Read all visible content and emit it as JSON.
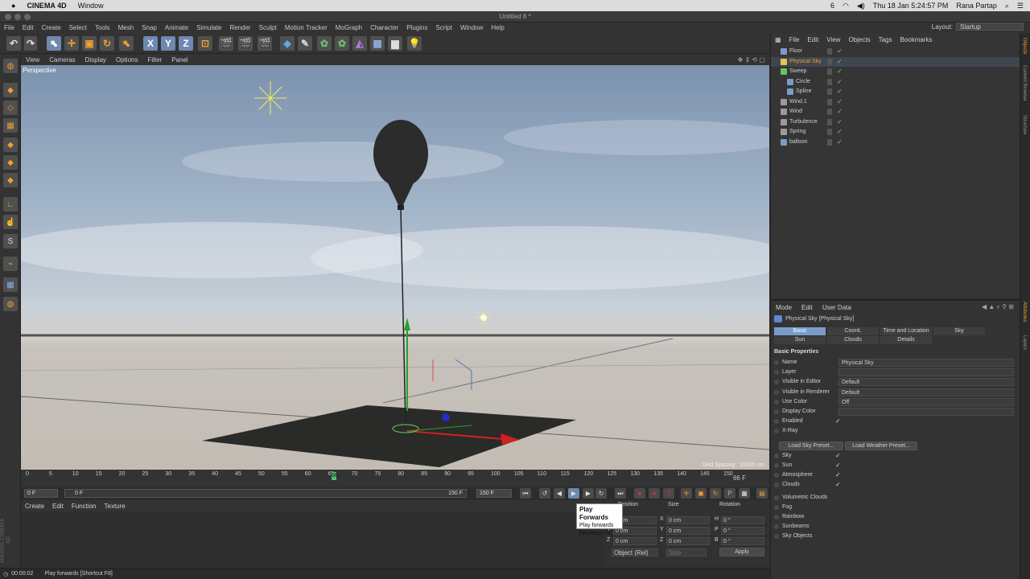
{
  "macbar": {
    "app": "CINEMA 4D",
    "window": "Window",
    "battery": "6",
    "datetime": "Thu 18 Jan  5:24:57 PM",
    "user": "Rana Partap"
  },
  "title": "Untitled 8 *",
  "menu": [
    "File",
    "Edit",
    "Create",
    "Select",
    "Tools",
    "Mesh",
    "Snap",
    "Animate",
    "Simulate",
    "Render",
    "Sculpt",
    "Motion Tracker",
    "MoGraph",
    "Character",
    "Plugins",
    "Script",
    "Window",
    "Help"
  ],
  "layout": {
    "label": "Layout:",
    "value": "Startup"
  },
  "viewport": {
    "menu": [
      "View",
      "Cameras",
      "Display",
      "Options",
      "Filter",
      "Panel"
    ],
    "label": "Perspective",
    "grid_spacing": "Grid Spacing : 10000 cm"
  },
  "timeline": {
    "ticks": [
      "0",
      "5",
      "10",
      "15",
      "20",
      "25",
      "30",
      "35",
      "40",
      "45",
      "50",
      "55",
      "60",
      "65",
      "70",
      "75",
      "80",
      "85",
      "90",
      "95",
      "100",
      "105",
      "110",
      "115",
      "120",
      "125",
      "130",
      "135",
      "140",
      "145",
      "150"
    ],
    "current_frame": "66 F",
    "start": "0 F",
    "min": "0 F",
    "max": "150 F",
    "end": "150 F",
    "play_frame": "66"
  },
  "material_menu": [
    "Create",
    "Edit",
    "Function",
    "Texture"
  ],
  "tooltip": {
    "title": "Play Forwards",
    "line1": "Play forwards",
    "line2": "[Shortcut F8]"
  },
  "coords": {
    "headers": [
      "Position",
      "Size",
      "Rotation"
    ],
    "rows": [
      {
        "axis": "X",
        "pos": "0 cm",
        "sizeaxis": "X",
        "size": "0 cm",
        "rotaxis": "H",
        "rot": "0 °"
      },
      {
        "axis": "Y",
        "pos": "0 cm",
        "sizeaxis": "Y",
        "size": "0 cm",
        "rotaxis": "P",
        "rot": "0 °"
      },
      {
        "axis": "Z",
        "pos": "0 cm",
        "sizeaxis": "Z",
        "size": "0 cm",
        "rotaxis": "B",
        "rot": "0 °"
      }
    ],
    "mode": "Object (Rel)",
    "size_mode": "Size",
    "apply": "Apply"
  },
  "maxon": "MAXON CINEMA 4D",
  "status": {
    "time": "00:00:02",
    "message": "Play forwards [Shortcut F8]"
  },
  "objects": {
    "menu": [
      "File",
      "Edit",
      "View",
      "Objects",
      "Tags",
      "Bookmarks"
    ],
    "items": [
      {
        "name": "Floor",
        "indent": 0,
        "color": "#7a9cc8"
      },
      {
        "name": "Physical Sky",
        "indent": 0,
        "color": "#e8c34a",
        "selected": true
      },
      {
        "name": "Sweep",
        "indent": 0,
        "color": "#6ac06a"
      },
      {
        "name": "Circle",
        "indent": 1,
        "color": "#7a9cc8"
      },
      {
        "name": "Spline",
        "indent": 1,
        "color": "#7a9cc8"
      },
      {
        "name": "Wind.1",
        "indent": 0,
        "color": "#9a9a9a"
      },
      {
        "name": "Wind",
        "indent": 0,
        "color": "#9a9a9a"
      },
      {
        "name": "Turbulence",
        "indent": 0,
        "color": "#9a9a9a"
      },
      {
        "name": "Spring",
        "indent": 0,
        "color": "#9a9a9a"
      },
      {
        "name": "balloon",
        "indent": 0,
        "color": "#7a9cc8"
      }
    ]
  },
  "attributes": {
    "menu": [
      "Mode",
      "Edit",
      "User Data"
    ],
    "title": "Physical Sky [Physical Sky]",
    "tabs": [
      [
        "Basic",
        "Coord.",
        "Time and Location",
        "Sky"
      ],
      [
        "Sun",
        "Clouds",
        "Details"
      ]
    ],
    "section": "Basic Properties",
    "props": [
      {
        "label": "Name",
        "value": "Physical Sky"
      },
      {
        "label": "Layer",
        "value": ""
      },
      {
        "label": "Visible in Editor",
        "value": "Default"
      },
      {
        "label": "Visible in Renderer",
        "value": "Default"
      },
      {
        "label": "Use Color",
        "value": "Off"
      },
      {
        "label": "Display Color",
        "value": ""
      }
    ],
    "checks1": [
      {
        "label": "Enabled",
        "value": "✓"
      },
      {
        "label": "X-Ray",
        "value": ""
      }
    ],
    "buttons": [
      "Load Sky Preset...",
      "Load Weather Preset..."
    ],
    "checks2": [
      {
        "label": "Sky",
        "value": "✓"
      },
      {
        "label": "Sun",
        "value": "✓"
      },
      {
        "label": "Atmosphere",
        "value": "✓"
      },
      {
        "label": "Clouds",
        "value": "✓"
      }
    ],
    "checks3": [
      {
        "label": "Volumetric Clouds",
        "value": ""
      },
      {
        "label": "Fog",
        "value": ""
      },
      {
        "label": "Rainbow",
        "value": ""
      },
      {
        "label": "Sunbeams",
        "value": ""
      },
      {
        "label": "Sky Objects",
        "value": ""
      }
    ]
  },
  "right_strip": [
    "Objects",
    "Content Browser",
    "Structure",
    "Attributes",
    "Layers"
  ]
}
